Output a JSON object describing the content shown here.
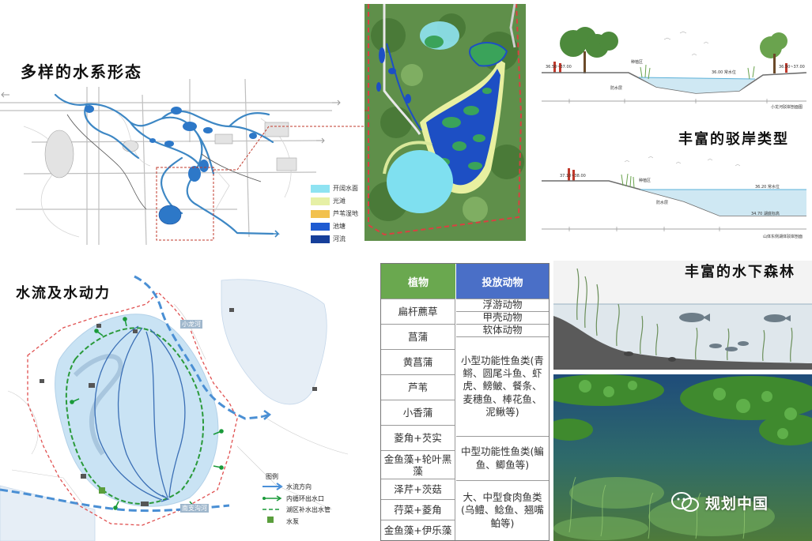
{
  "headings": {
    "water_forms": "多样的水系形态",
    "shore_types": "丰富的驳岸类型",
    "flow": "水流及水动力",
    "underwater": "丰富的水下森林"
  },
  "map_legend": [
    {
      "label": "开阔水面",
      "color": "#8fe3f2"
    },
    {
      "label": "光滩",
      "color": "#e6f0a6"
    },
    {
      "label": "芦苇湿地",
      "color": "#f2c14e"
    },
    {
      "label": "池塘",
      "color": "#1f5bd1"
    },
    {
      "label": "河流",
      "color": "#163f9a"
    }
  ],
  "section_labels": {
    "upper_title": "小龙河驳岸剖面图",
    "lower_title": "山体东侧湖体驳岸剖面",
    "upper_left_tag": "36.50~37.00",
    "upper_right_tag": "36.50~37.00",
    "upper_water": "36.00 常水位",
    "lower_left_tag": "37.10~38.00",
    "lower_water": "36.20 常水位",
    "lower_bottom": "34.70 湖底标高",
    "waterproof": "防水层",
    "planting": "种植区"
  },
  "flow_legend": {
    "title": "图例",
    "items": [
      {
        "label": "水流方向",
        "color": "#4a90d9"
      },
      {
        "label": "内循环出水口",
        "color": "#1a9a3a"
      },
      {
        "label": "湖区补水出水管",
        "color": "#1a9a3a"
      },
      {
        "label": "水泵",
        "color": "#6aa84f"
      }
    ],
    "river_north": "小龙河",
    "river_south": "南支沟河"
  },
  "table": {
    "plant_header": "植物",
    "animal_header": "投放动物",
    "plant_header_color": "#6aa84f",
    "animal_header_color": "#4a6fc7",
    "plants": [
      "扁杆藨草",
      "菖蒲",
      "黄菖蒲",
      "芦苇",
      "小香蒲",
      "菱角+芡实",
      "金鱼藻+轮叶黑藻",
      "泽芹+茨菇",
      "荇菜+菱角",
      "金鱼藻+伊乐藻"
    ],
    "animals": [
      "浮游动物",
      "甲壳动物",
      "软体动物",
      "小型功能性鱼类(青鳉、圆尾斗鱼、虾虎、鳑鲏、餐条、麦穗鱼、棒花鱼、泥鳅等)",
      "中型功能性鱼类(鳊鱼、鲫鱼等)",
      "大、中型食肉鱼类(乌鳢、鲶鱼、翘嘴鲌等)"
    ]
  },
  "watermark": "规划中国"
}
